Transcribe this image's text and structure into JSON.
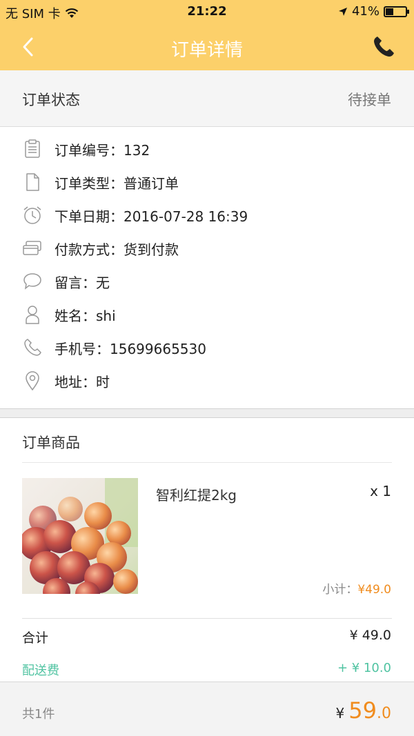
{
  "status_bar": {
    "carrier": "无 SIM 卡",
    "time": "21:22",
    "battery": "41%",
    "battery_level": 0.41
  },
  "nav": {
    "title": "订单详情"
  },
  "order_status": {
    "label": "订单状态",
    "value": "待接单"
  },
  "info": [
    {
      "icon": "clipboard-icon",
      "text": "订单编号：132"
    },
    {
      "icon": "document-icon",
      "text": "订单类型：普通订单"
    },
    {
      "icon": "alarm-clock-icon",
      "text": "下单日期：2016-07-28 16:39"
    },
    {
      "icon": "payment-card-icon",
      "text": "付款方式：货到付款"
    },
    {
      "icon": "speech-bubble-icon",
      "text": "留言：无"
    },
    {
      "icon": "person-icon",
      "text": "姓名：shi"
    },
    {
      "icon": "phone-icon",
      "text": "手机号：15699665530"
    },
    {
      "icon": "location-pin-icon",
      "text": "地址：时"
    }
  ],
  "goods": {
    "title": "订单商品",
    "product": {
      "name": "智利红提2kg",
      "qty": "x 1",
      "subtotal_label": "小计：",
      "subtotal_value": "¥49.0"
    },
    "total_label": "合计",
    "total_value": "¥ 49.0",
    "fee_label": "配送费",
    "fee_value": "+ ¥ 10.0"
  },
  "footer": {
    "count": "共1件",
    "currency": "¥",
    "price_int": "59",
    "price_dec": ".0"
  },
  "colors": {
    "accent": "#fcd06a",
    "price": "#f08c1e",
    "fee": "#4fc3a1"
  }
}
